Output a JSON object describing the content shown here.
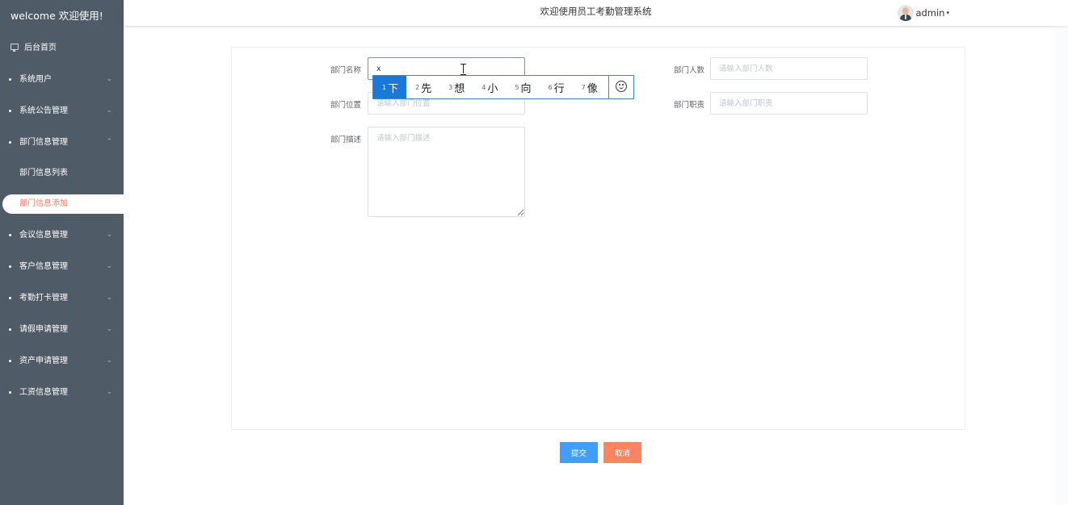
{
  "sidebar": {
    "brand": "welcome 欢迎使用!",
    "home": "后台首页",
    "items": [
      {
        "label": "系统用户",
        "arrow": "⌄"
      },
      {
        "label": "系统公告管理",
        "arrow": "⌄"
      },
      {
        "label": "部门信息管理",
        "arrow": "⌃"
      },
      {
        "label": "会议信息管理",
        "arrow": "⌄"
      },
      {
        "label": "客户信息管理",
        "arrow": "⌄"
      },
      {
        "label": "考勤打卡管理",
        "arrow": "⌄"
      },
      {
        "label": "请假申请管理",
        "arrow": "⌄"
      },
      {
        "label": "资产申请管理",
        "arrow": "⌄"
      },
      {
        "label": "工资信息管理",
        "arrow": "⌄"
      }
    ],
    "submenu": [
      {
        "label": "部门信息列表"
      },
      {
        "label": "部门信息添加"
      }
    ]
  },
  "header": {
    "title": "欢迎使用员工考勤管理系统",
    "username": "admin",
    "caret": "▾"
  },
  "form": {
    "name": {
      "label": "部门名称",
      "value": "x",
      "placeholder": ""
    },
    "count": {
      "label": "部门人数",
      "placeholder": "请输入部门人数"
    },
    "location": {
      "label": "部门位置",
      "placeholder": "请输入部门位置"
    },
    "duty": {
      "label": "部门职责",
      "placeholder": "请输入部门职责"
    },
    "desc": {
      "label": "部门描述",
      "placeholder": "请输入部门描述"
    }
  },
  "ime": {
    "candidates": [
      {
        "num": "1",
        "text": "下"
      },
      {
        "num": "2",
        "text": "先"
      },
      {
        "num": "3",
        "text": "想"
      },
      {
        "num": "4",
        "text": "小"
      },
      {
        "num": "5",
        "text": "向"
      },
      {
        "num": "6",
        "text": "行"
      },
      {
        "num": "7",
        "text": "像"
      }
    ]
  },
  "buttons": {
    "submit": "提交",
    "cancel": "取消"
  },
  "colors": {
    "sidebar_bg": "#4f5b66",
    "active_text": "#f27c5d",
    "primary": "#409eff",
    "cancel": "#f9845f"
  }
}
